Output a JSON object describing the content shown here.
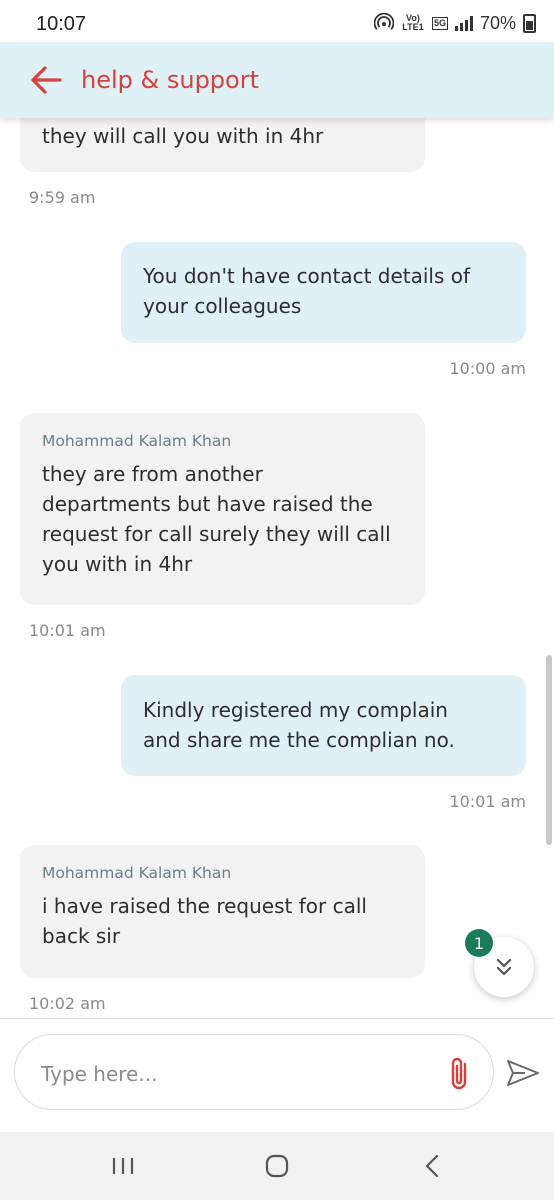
{
  "status_bar": {
    "time": "10:07",
    "network_volte": "Vo) LTE1",
    "network_5g": "5G",
    "battery": "70%"
  },
  "header": {
    "title": "help & support",
    "back_icon": "arrow-left-icon",
    "accent_color": "#d8403b",
    "background": "#dff0f7"
  },
  "messages": [
    {
      "direction": "in",
      "sender": "",
      "text": "they will call you with in 4hr",
      "time": "9:59 am"
    },
    {
      "direction": "out",
      "lines": [
        "You don't have contact details of",
        "your colleagues"
      ],
      "time": "10:00 am"
    },
    {
      "direction": "in",
      "sender": "Mohammad Kalam Khan",
      "lines": [
        "they are from another",
        "departments but have raised the",
        "request for call surely they will call",
        "you with in 4hr"
      ],
      "time": "10:01 am"
    },
    {
      "direction": "out",
      "lines": [
        "Kindly registered my complain",
        "and share me the complian no."
      ],
      "time": "10:01 am"
    },
    {
      "direction": "in",
      "sender": "Mohammad Kalam Khan",
      "lines": [
        "i have raised the request for call",
        "back sir"
      ],
      "time": "10:02 am"
    }
  ],
  "scroll_fab": {
    "icon": "double-chevron-down-icon",
    "unread_count": "1",
    "badge_color": "#1b7a5a"
  },
  "composer": {
    "placeholder": "Type here...",
    "attach_icon": "paperclip-icon",
    "send_icon": "send-icon"
  },
  "navbar": {
    "recents_icon": "recents-icon",
    "home_icon": "home-icon",
    "back_icon": "back-chevron-icon"
  }
}
